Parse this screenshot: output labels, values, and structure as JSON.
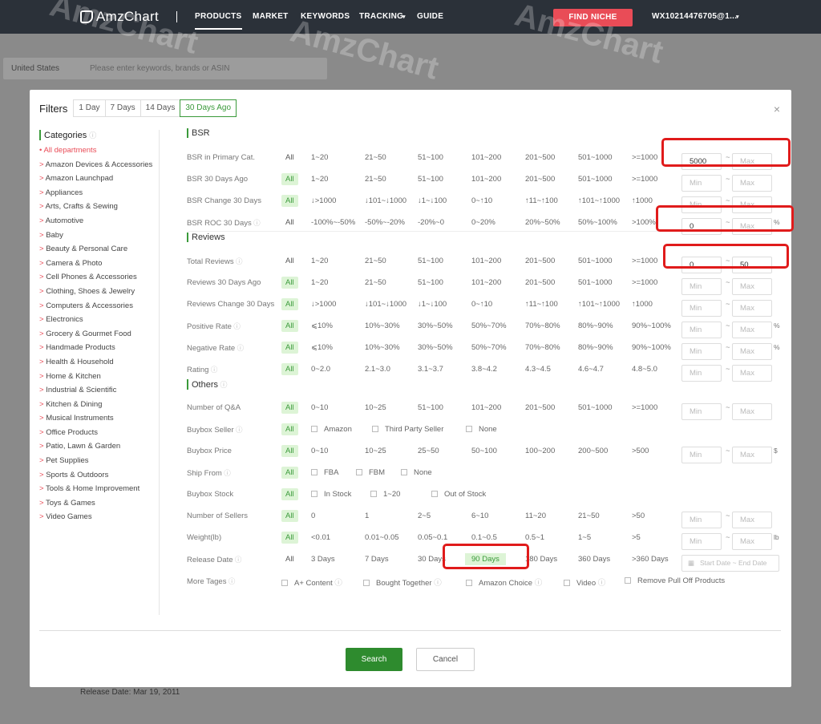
{
  "nav": {
    "logo": "AmzChart",
    "items": [
      "PRODUCTS",
      "MARKET",
      "KEYWORDS",
      "TRACKING",
      "GUIDE"
    ],
    "find_niche": "FIND NICHE",
    "user": "WX10214476705@1..."
  },
  "background": {
    "country": "United States",
    "search_placeholder": "Please enter keywords, brands or ASIN",
    "release_date": "Release Date: Mar 19, 2011"
  },
  "modal": {
    "title": "Filters",
    "tabs": [
      "1 Day",
      "7 Days",
      "14 Days",
      "30 Days Ago"
    ],
    "categories_title": "Categories",
    "categories": [
      "All departments",
      "> Amazon Devices & Accessories",
      "> Amazon Launchpad",
      "> Appliances",
      "> Arts, Crafts & Sewing",
      "> Automotive",
      "> Baby",
      "> Beauty & Personal Care",
      "> Camera & Photo",
      "> Cell Phones & Accessories",
      "> Clothing, Shoes & Jewelry",
      "> Computers & Accessories",
      "> Electronics",
      "> Grocery & Gourmet Food",
      "> Handmade Products",
      "> Health & Household",
      "> Home & Kitchen",
      "> Industrial & Scientific",
      "> Kitchen & Dining",
      "> Musical Instruments",
      "> Office Products",
      "> Patio, Lawn & Garden",
      "> Pet Supplies",
      "> Sports & Outdoors",
      "> Tools & Home Improvement",
      "> Toys & Games",
      "> Video Games"
    ],
    "sections": {
      "bsr": "BSR",
      "reviews": "Reviews",
      "others": "Others"
    },
    "all": "All",
    "min": "Min",
    "max": "Max",
    "start_date": "Start Date",
    "end_date": "End Date",
    "search": "Search",
    "cancel": "Cancel"
  },
  "rows": {
    "bsr_primary": {
      "label": "BSR in Primary Cat.",
      "options": [
        "1~20",
        "21~50",
        "51~100",
        "101~200",
        "201~500",
        "501~1000",
        ">=1000"
      ],
      "min": "5000",
      "max": ""
    },
    "bsr_30": {
      "label": "BSR 30 Days Ago",
      "options": [
        "1~20",
        "21~50",
        "51~100",
        "101~200",
        "201~500",
        "501~1000",
        ">=1000"
      ]
    },
    "bsr_change": {
      "label": "BSR Change 30 Days",
      "options": [
        "↓>1000",
        "↓101~↓1000",
        "↓1~↓100",
        "0~↑10",
        "↑11~↑100",
        "↑101~↑1000",
        "↑1000"
      ]
    },
    "bsr_roc": {
      "label": "BSR ROC 30 Days",
      "options": [
        "-100%~-50%",
        "-50%~-20%",
        "-20%~0",
        "0~20%",
        "20%~50%",
        "50%~100%",
        ">100%"
      ],
      "min": "0",
      "unit": "%"
    },
    "total_reviews": {
      "label": "Total Reviews",
      "options": [
        "1~20",
        "21~50",
        "51~100",
        "101~200",
        "201~500",
        "501~1000",
        ">=1000"
      ],
      "min": "0",
      "max": "50"
    },
    "reviews_30": {
      "label": "Reviews 30 Days Ago",
      "options": [
        "1~20",
        "21~50",
        "51~100",
        "101~200",
        "201~500",
        "501~1000",
        ">=1000"
      ]
    },
    "reviews_change": {
      "label": "Reviews Change 30 Days",
      "options": [
        "↓>1000",
        "↓101~↓1000",
        "↓1~↓100",
        "0~↑10",
        "↑11~↑100",
        "↑101~↑1000",
        "↑1000"
      ]
    },
    "positive_rate": {
      "label": "Positive Rate",
      "options": [
        "⩽10%",
        "10%~30%",
        "30%~50%",
        "50%~70%",
        "70%~80%",
        "80%~90%",
        "90%~100%"
      ],
      "unit": "%"
    },
    "negative_rate": {
      "label": "Negative Rate",
      "options": [
        "⩽10%",
        "10%~30%",
        "30%~50%",
        "50%~70%",
        "70%~80%",
        "80%~90%",
        "90%~100%"
      ],
      "unit": "%"
    },
    "rating": {
      "label": "Rating",
      "options": [
        "0~2.0",
        "2.1~3.0",
        "3.1~3.7",
        "3.8~4.2",
        "4.3~4.5",
        "4.6~4.7",
        "4.8~5.0"
      ]
    },
    "qa": {
      "label": "Number of Q&A",
      "options": [
        "0~10",
        "10~25",
        "51~100",
        "101~200",
        "201~500",
        "501~1000",
        ">=1000"
      ]
    },
    "buybox_seller": {
      "label": "Buybox Seller",
      "options": [
        "Amazon",
        "Third Party Seller",
        "None"
      ]
    },
    "buybox_price": {
      "label": "Buybox Price",
      "options": [
        "0~10",
        "10~25",
        "25~50",
        "50~100",
        "100~200",
        "200~500",
        ">500"
      ],
      "unit": "$"
    },
    "ship_from": {
      "label": "Ship From",
      "options": [
        "FBA",
        "FBM",
        "None"
      ]
    },
    "buybox_stock": {
      "label": "Buybox Stock",
      "options": [
        "In Stock",
        "1~20",
        "Out of Stock"
      ]
    },
    "sellers": {
      "label": "Number of Sellers",
      "options": [
        "0",
        "1",
        "2~5",
        "6~10",
        "11~20",
        "21~50",
        ">50"
      ]
    },
    "weight": {
      "label": "Weight(lb)",
      "options": [
        "<0.01",
        "0.01~0.05",
        "0.05~0.1",
        "0.1~0.5",
        "0.5~1",
        "1~5",
        ">5"
      ],
      "unit": "lb"
    },
    "release_date": {
      "label": "Release Date",
      "options": [
        "3 Days",
        "7 Days",
        "30 Days",
        "90 Days",
        "180 Days",
        "360 Days",
        ">360 Days"
      ]
    },
    "more_tags": {
      "label": "More Tages",
      "options": [
        "A+ Content",
        "Bought Together",
        "Amazon Choice",
        "Video",
        "Remove Pull Off Products"
      ]
    }
  },
  "colors": {
    "accent": "#3a9a3a",
    "highlight": "#ddf4d6",
    "red": "#e01b1b",
    "nav": "#2b3139"
  }
}
